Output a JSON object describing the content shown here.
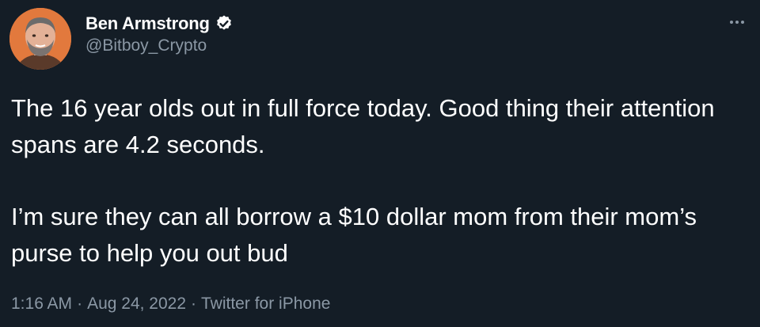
{
  "author": {
    "display_name": "Ben Armstrong",
    "handle": "@Bitboy_Crypto",
    "verified": true,
    "avatar_bg": "#e2793d"
  },
  "tweet": {
    "paragraphs": [
      "The 16 year olds out in full force today. Good thing their attention spans are 4.2 seconds.",
      "I’m sure they can all borrow a $10 dollar mom from their mom’s purse to help you out bud"
    ],
    "time": "1:16 AM",
    "date": "Aug 24, 2022",
    "source": "Twitter for iPhone",
    "separator": "·"
  },
  "icons": {
    "verified": "verified-badge-icon",
    "more": "more-options-icon"
  },
  "colors": {
    "background": "#141d26",
    "text": "#ffffff",
    "secondary_text": "#8b98a5",
    "verified_badge": "#ffffff"
  }
}
